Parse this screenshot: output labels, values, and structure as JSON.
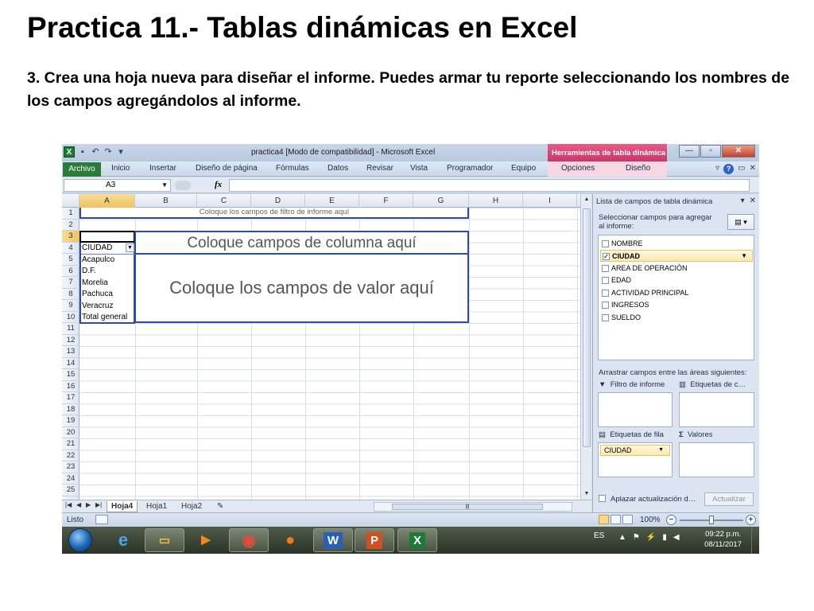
{
  "slide": {
    "title": "Practica 11.- Tablas dinámicas en Excel",
    "instruction": "3. Crea una hoja nueva para diseñar el informe. Puedes armar tu reporte seleccionando los nombres de los campos agregándolos al informe."
  },
  "window": {
    "title": "practica4  [Modo de compatibilidad]  -  Microsoft Excel",
    "context_tools": "Herramientas de tabla dinámica",
    "buttons": {
      "minimize": "—",
      "maximize": "▫",
      "close": "✕"
    }
  },
  "ribbon": {
    "file_tab": "Archivo",
    "tabs": [
      "Inicio",
      "Insertar",
      "Diseño de página",
      "Fórmulas",
      "Datos",
      "Revisar",
      "Vista",
      "Programador",
      "Equipo",
      "Opciones",
      "Diseño"
    ]
  },
  "formula_bar": {
    "name_box": "A3",
    "fx": "fx",
    "formula": ""
  },
  "sheet": {
    "columns": [
      "A",
      "B",
      "C",
      "D",
      "E",
      "F",
      "G",
      "H",
      "I"
    ],
    "rows": [
      "1",
      "2",
      "3",
      "4",
      "5",
      "6",
      "7",
      "8",
      "9",
      "10",
      "11",
      "12",
      "13",
      "14",
      "15",
      "16",
      "17",
      "18",
      "19",
      "20",
      "21",
      "22",
      "23",
      "24",
      "25"
    ],
    "selected_column": "A",
    "selected_row": "3",
    "pivot": {
      "filter_placeholder": "Coloque los campos de filtro de informe aquí",
      "column_placeholder": "Coloque campos de columna aquí",
      "values_placeholder": "Coloque los campos de valor aquí",
      "row_header": "CIUDAD",
      "row_items": [
        "Acapulco",
        "D.F.",
        "Morelia",
        "Pachuca",
        "Veracruz"
      ],
      "grand_total": "Total general"
    }
  },
  "sheet_tabs": [
    "Hoja4",
    "Hoja1",
    "Hoja2"
  ],
  "active_sheet": "Hoja4",
  "field_list": {
    "title": "Lista de campos de tabla dinámica",
    "select_label": "Seleccionar campos para agregar al informe:",
    "fields": [
      {
        "name": "NOMBRE",
        "checked": false
      },
      {
        "name": "CIUDAD",
        "checked": true
      },
      {
        "name": "AREA DE OPERACIÓN",
        "checked": false
      },
      {
        "name": "EDAD",
        "checked": false
      },
      {
        "name": "ACTIVIDAD PRINCIPAL",
        "checked": false
      },
      {
        "name": "INGRESOS",
        "checked": false
      },
      {
        "name": "SUELDO",
        "checked": false
      }
    ],
    "drag_label": "Arrastrar campos entre las áreas siguientes:",
    "areas": {
      "filter": "Filtro de informe",
      "columns": "Etiquetas de c…",
      "rows": "Etiquetas de fila",
      "values": "Valores",
      "sigma": "Σ"
    },
    "row_area_item": "CIUDAD",
    "defer_label": "Aplazar actualización d…",
    "update_button": "Actualizar"
  },
  "status_bar": {
    "ready": "Listo",
    "zoom": "100%"
  },
  "taskbar": {
    "language": "ES",
    "time": "09:22 p.m.",
    "date": "08/11/2017",
    "apps": [
      "internet-explorer",
      "file-explorer",
      "media-player",
      "chrome",
      "firefox",
      "word",
      "powerpoint",
      "excel"
    ],
    "labels": {
      "word": "W",
      "powerpoint": "P",
      "excel": "X"
    }
  },
  "colors": {
    "pivot_border": "#2f4aa8",
    "file_tab": "#2a7a3a",
    "context_tab": "#c93768"
  }
}
